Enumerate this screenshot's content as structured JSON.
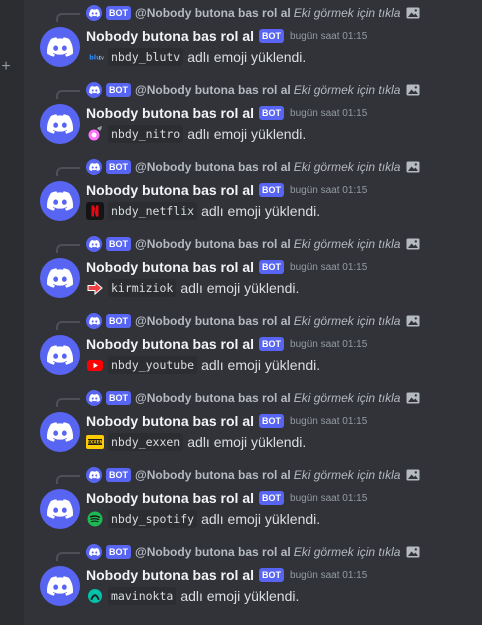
{
  "reply": {
    "badge": "BOT",
    "author": "@Nobody butona bas rol al",
    "hint": "Eki görmek için tıkla"
  },
  "author": "Nobody butona bas rol al",
  "badge": "BOT",
  "timestamp": "bugün saat 01:15",
  "suffix": "adlı emoji yüklendi.",
  "sidebar": {
    "plus_label": "+"
  },
  "messages": [
    {
      "emoji_name": "nbdy_blutv",
      "emoji_icon": "blutv-emoji-icon"
    },
    {
      "emoji_name": "nbdy_nitro",
      "emoji_icon": "nitro-emoji-icon"
    },
    {
      "emoji_name": "nbdy_netflix",
      "emoji_icon": "netflix-emoji-icon"
    },
    {
      "emoji_name": "kirmiziok",
      "emoji_icon": "red-arrow-emoji-icon"
    },
    {
      "emoji_name": "nbdy_youtube",
      "emoji_icon": "youtube-emoji-icon"
    },
    {
      "emoji_name": "nbdy_exxen",
      "emoji_icon": "exxen-emoji-icon"
    },
    {
      "emoji_name": "nbdy_spotify",
      "emoji_icon": "spotify-emoji-icon"
    },
    {
      "emoji_name": "mavinokta",
      "emoji_icon": "blue-dot-emoji-icon"
    }
  ],
  "colors": {
    "background": "#313338",
    "blurple": "#5865f2",
    "author": "#f2f3f5",
    "muted": "#949ba4"
  }
}
